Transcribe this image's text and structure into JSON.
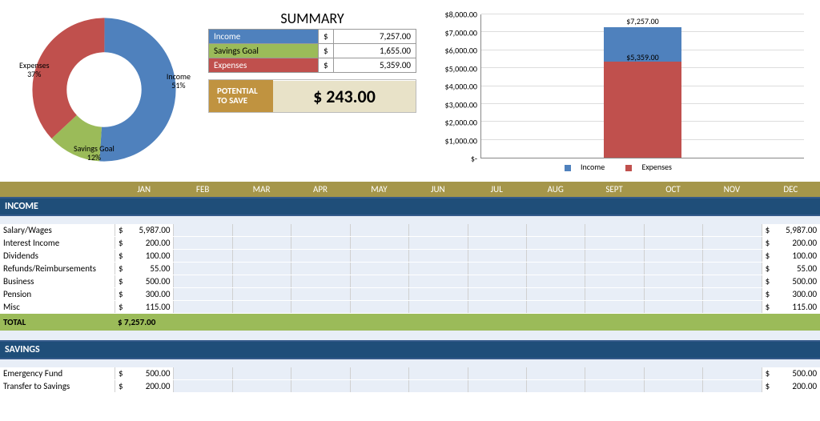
{
  "summary": {
    "title": "SUMMARY",
    "rows": [
      {
        "label": "Income",
        "cur": "$",
        "val": "7,257.00"
      },
      {
        "label": "Savings Goal",
        "cur": "$",
        "val": "1,655.00"
      },
      {
        "label": "Expenses",
        "cur": "$",
        "val": "5,359.00"
      }
    ],
    "potential_label": "POTENTIAL TO SAVE",
    "potential_value": "$   243.00"
  },
  "donut": {
    "slices": [
      {
        "name": "Income",
        "pct": "51%",
        "color": "#4f81bd"
      },
      {
        "name": "Savings Goal",
        "pct": "12%",
        "color": "#9bbb59"
      },
      {
        "name": "Expenses",
        "pct": "37%",
        "color": "#c0504d"
      }
    ]
  },
  "bar": {
    "yticks": [
      "$8,000.00",
      "$7,000.00",
      "$6,000.00",
      "$5,000.00",
      "$4,000.00",
      "$3,000.00",
      "$2,000.00",
      "$1,000.00",
      "$-"
    ],
    "income_label": "$7,257.00",
    "expenses_label": "$5,359.00",
    "legend_income": "Income",
    "legend_expenses": "Expenses"
  },
  "months": [
    "JAN",
    "FEB",
    "MAR",
    "APR",
    "MAY",
    "JUN",
    "JUL",
    "AUG",
    "SEPT",
    "OCT",
    "NOV",
    "DEC"
  ],
  "income": {
    "header": "INCOME",
    "rows": [
      {
        "label": "Salary/Wages",
        "jan": "5,987.00",
        "tot": "5,987.00"
      },
      {
        "label": "Interest Income",
        "jan": "200.00",
        "tot": "200.00"
      },
      {
        "label": "Dividends",
        "jan": "100.00",
        "tot": "100.00"
      },
      {
        "label": "Refunds/Reimbursements",
        "jan": "55.00",
        "tot": "55.00"
      },
      {
        "label": "Business",
        "jan": "500.00",
        "tot": "500.00"
      },
      {
        "label": "Pension",
        "jan": "300.00",
        "tot": "300.00"
      },
      {
        "label": "Misc",
        "jan": "115.00",
        "tot": "115.00"
      }
    ],
    "total_label": "TOTAL",
    "total_val": "$  7,257.00"
  },
  "savings": {
    "header": "SAVINGS",
    "rows": [
      {
        "label": "Emergency Fund",
        "jan": "500.00",
        "tot": "500.00"
      },
      {
        "label": "Transfer to Savings",
        "jan": "200.00",
        "tot": "200.00"
      }
    ]
  },
  "chart_data": [
    {
      "type": "pie",
      "title": "",
      "series": [
        {
          "name": "Income",
          "value": 51,
          "color": "#4f81bd"
        },
        {
          "name": "Savings Goal",
          "value": 12,
          "color": "#9bbb59"
        },
        {
          "name": "Expenses",
          "value": 37,
          "color": "#c0504d"
        }
      ]
    },
    {
      "type": "bar",
      "categories": [
        ""
      ],
      "series": [
        {
          "name": "Expenses",
          "values": [
            5359
          ],
          "color": "#c0504d"
        },
        {
          "name": "Income",
          "values": [
            7257
          ],
          "color": "#4f81bd"
        }
      ],
      "stacked": true,
      "ylim": [
        0,
        8000
      ],
      "ylabel": "",
      "data_labels": [
        "$7,257.00",
        "$5,359.00"
      ]
    }
  ]
}
